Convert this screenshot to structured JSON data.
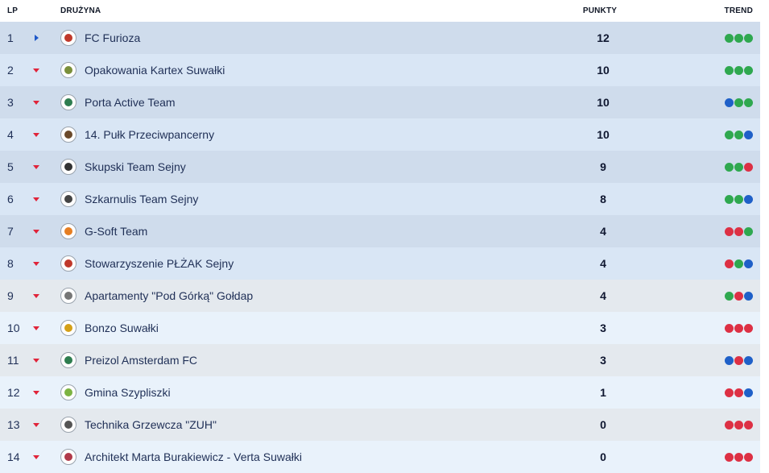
{
  "header": {
    "lp": "LP",
    "team": "DRUŻYNA",
    "points": "PUNKTY",
    "trend": "TREND"
  },
  "colors": {
    "win": "#2fa84f",
    "loss": "#dd3044",
    "draw": "#1f60c8",
    "arrow_down": "#e0243a",
    "arrow_up": "#1e58c8"
  },
  "rows": [
    {
      "pos": "1",
      "move": "right",
      "team": "FC Furioza",
      "points": "12",
      "trend": [
        "W",
        "W",
        "W"
      ],
      "logo_color": "#c0392b"
    },
    {
      "pos": "2",
      "move": "down",
      "team": "Opakowania Kartex Suwałki",
      "points": "10",
      "trend": [
        "W",
        "W",
        "W"
      ],
      "logo_color": "#7a8f3a"
    },
    {
      "pos": "3",
      "move": "down",
      "team": "Porta Active Team",
      "points": "10",
      "trend": [
        "D",
        "W",
        "W"
      ],
      "logo_color": "#2e7d4f"
    },
    {
      "pos": "4",
      "move": "down",
      "team": "14. Pułk Przeciwpancerny",
      "points": "10",
      "trend": [
        "W",
        "W",
        "D"
      ],
      "logo_color": "#6b4a2b"
    },
    {
      "pos": "5",
      "move": "down",
      "team": "Skupski Team Sejny",
      "points": "9",
      "trend": [
        "W",
        "W",
        "L"
      ],
      "logo_color": "#333333"
    },
    {
      "pos": "6",
      "move": "down",
      "team": "Szkarnulis Team Sejny",
      "points": "8",
      "trend": [
        "W",
        "W",
        "D"
      ],
      "logo_color": "#444444"
    },
    {
      "pos": "7",
      "move": "down",
      "team": "G-Soft Team",
      "points": "4",
      "trend": [
        "L",
        "L",
        "W"
      ],
      "logo_color": "#e67e22"
    },
    {
      "pos": "8",
      "move": "down",
      "team": "Stowarzyszenie PŁŻAK Sejny",
      "points": "4",
      "trend": [
        "L",
        "W",
        "D"
      ],
      "logo_color": "#c0392b"
    },
    {
      "pos": "9",
      "move": "down",
      "team": "Apartamenty \"Pod Górką\" Gołdap",
      "points": "4",
      "trend": [
        "W",
        "L",
        "D"
      ],
      "logo_color": "#777777"
    },
    {
      "pos": "10",
      "move": "down",
      "team": "Bonzo Suwałki",
      "points": "3",
      "trend": [
        "L",
        "L",
        "L"
      ],
      "logo_color": "#d4a017"
    },
    {
      "pos": "11",
      "move": "down",
      "team": "Preizol Amsterdam FC",
      "points": "3",
      "trend": [
        "D",
        "L",
        "D"
      ],
      "logo_color": "#2e7d4f"
    },
    {
      "pos": "12",
      "move": "down",
      "team": "Gmina Szypliszki",
      "points": "1",
      "trend": [
        "L",
        "L",
        "D"
      ],
      "logo_color": "#7cb342"
    },
    {
      "pos": "13",
      "move": "down",
      "team": "Technika Grzewcza \"ZUH\"",
      "points": "0",
      "trend": [
        "L",
        "L",
        "L"
      ],
      "logo_color": "#555555"
    },
    {
      "pos": "14",
      "move": "down",
      "team": "Architekt Marta Burakiewicz - Verta Suwałki",
      "points": "0",
      "trend": [
        "L",
        "L",
        "L"
      ],
      "logo_color": "#b03a4a"
    }
  ]
}
